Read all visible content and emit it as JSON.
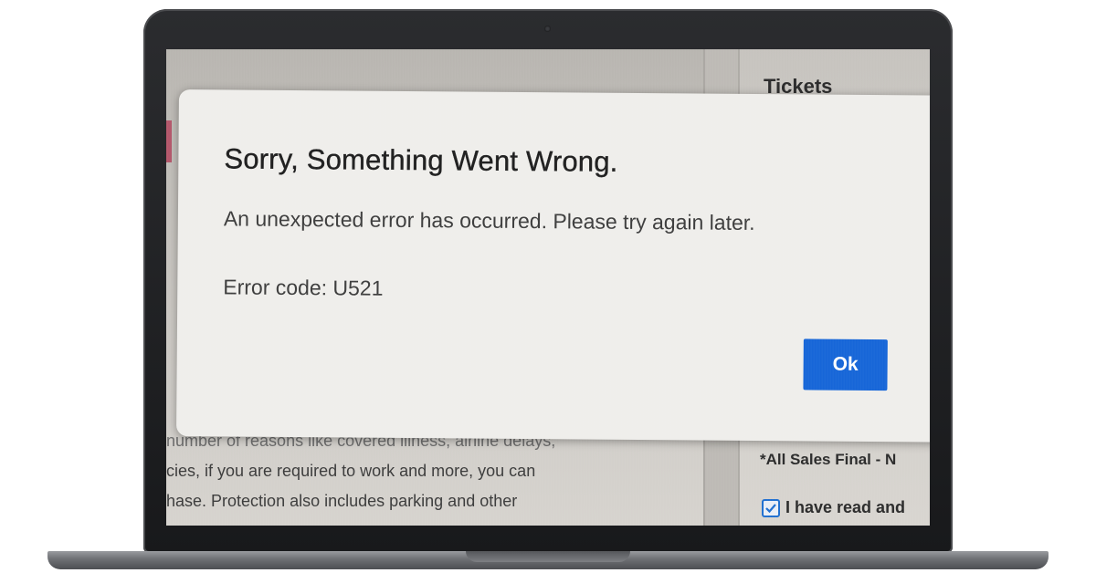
{
  "background_page": {
    "sidebar_heading": "Tickets",
    "paragraph_lines": [
      "number of reasons like covered illness, airline delays,",
      "cies, if you are required to work and more, you can",
      "hase. Protection also includes parking and other"
    ],
    "sales_notice": "*All Sales Final - N",
    "agree_checkbox": {
      "checked": true,
      "label": "I have read and"
    }
  },
  "dialog": {
    "title": "Sorry, Something Went Wrong.",
    "message": "An unexpected error has occurred. Please try again later.",
    "error_code": "Error code: U521",
    "ok_label": "Ok"
  },
  "colors": {
    "ok_button": "#1565d8",
    "dialog_background": "#efeeeb",
    "laptop_bezel": "#1f2023",
    "checkbox_accent": "#1f6fd0"
  }
}
